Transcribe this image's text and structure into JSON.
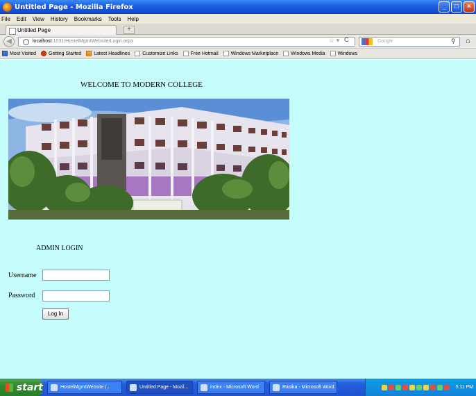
{
  "window": {
    "title": "Untitled Page - Mozilla Firefox"
  },
  "menu": [
    "File",
    "Edit",
    "View",
    "History",
    "Bookmarks",
    "Tools",
    "Help"
  ],
  "tab": {
    "label": "Untitled Page",
    "new_tab": "+"
  },
  "nav": {
    "url_host": "localhost",
    "url_rest": ":1031/HostelMgmtWebsite/Login.aspx",
    "search_placeholder": "Google"
  },
  "bookmarks": [
    "Most Visited",
    "Getting Started",
    "Latest Headlines",
    "Customize Links",
    "Free Hotmail",
    "Windows Marketplace",
    "Windows Media",
    "Windows"
  ],
  "page": {
    "welcome": "WELCOME TO MODERN COLLEGE",
    "admin_heading": "ADMIN LOGIN",
    "username_label": "Username",
    "password_label": "Password",
    "username_value": "",
    "password_value": "",
    "login_button": "Log In"
  },
  "taskbar": {
    "start": "start",
    "tasks": [
      "HostelMgmtWebsite (...",
      "Untitled Page - Mozil...",
      "index - Microsoft Word",
      "Rasika - Microsoft Word"
    ],
    "clock": "5:11 PM"
  }
}
